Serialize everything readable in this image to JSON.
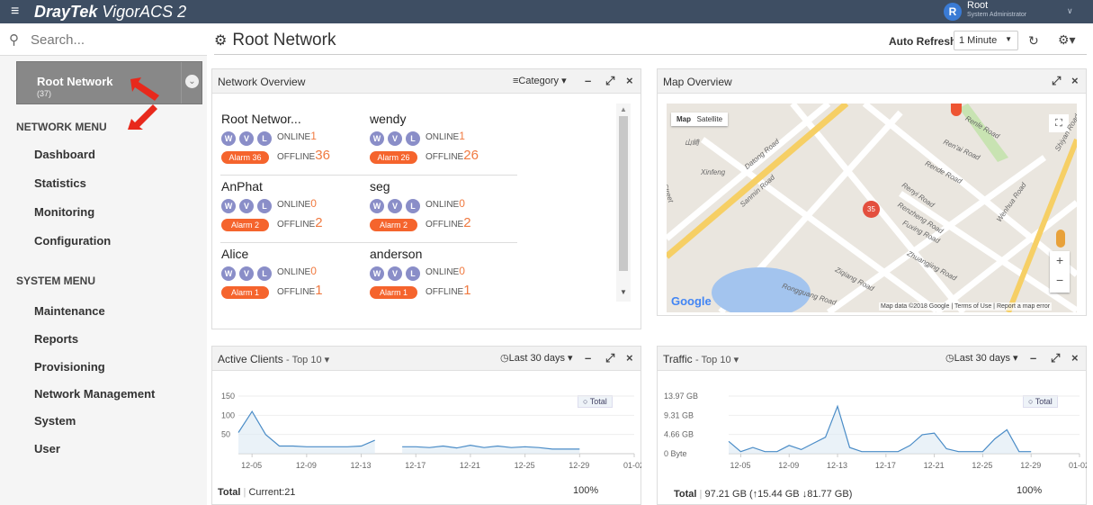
{
  "topbar": {
    "brand": "DrayTek",
    "product": "VigorACS 2",
    "user_initial": "R",
    "user_name": "Root",
    "user_role": "System Administrator"
  },
  "search": {
    "placeholder": "Search..."
  },
  "root_node": {
    "label": "Root Network",
    "count": "(37)"
  },
  "network_menu": {
    "heading": "NETWORK MENU",
    "items": [
      "Dashboard",
      "Statistics",
      "Monitoring",
      "Configuration"
    ]
  },
  "system_menu": {
    "heading": "SYSTEM MENU",
    "items": [
      "Maintenance",
      "Reports",
      "Provisioning",
      "Network Management",
      "System",
      "User"
    ]
  },
  "page": {
    "title": "Root Network",
    "auto_refresh_label": "Auto Refresh:",
    "auto_refresh_value": "1 Minute"
  },
  "network_overview": {
    "title": "Network Overview",
    "category_label": "Category",
    "online_label": "ONLINE",
    "offline_label": "OFFLINE",
    "badges": [
      "W",
      "V",
      "L"
    ],
    "devices": [
      {
        "name": "Root Networ...",
        "online": "1",
        "offline": "36",
        "alarm": "Alarm 36"
      },
      {
        "name": "wendy",
        "online": "1",
        "offline": "26",
        "alarm": "Alarm 26"
      },
      {
        "name": "AnPhat",
        "online": "0",
        "offline": "2",
        "alarm": "Alarm 2"
      },
      {
        "name": "seg",
        "online": "0",
        "offline": "2",
        "alarm": "Alarm 2"
      },
      {
        "name": "Alice",
        "online": "0",
        "offline": "1",
        "alarm": "Alarm 1"
      },
      {
        "name": "anderson",
        "online": "0",
        "offline": "1",
        "alarm": "Alarm 1"
      }
    ]
  },
  "map_overview": {
    "title": "Map Overview",
    "tab_map": "Map",
    "tab_satellite": "Satellite",
    "cluster_count": "35",
    "logo": "Google",
    "attribution": "Map data ©2018 Google",
    "terms": "Terms of Use",
    "report": "Report a map error",
    "zoom_in": "+",
    "zoom_out": "−",
    "places": [
      "Renle Road",
      "Ren'ai Road",
      "Rende Road",
      "Renyi Road",
      "Renzheng Road",
      "Fuxing Road",
      "Zhuangjing Road",
      "Ziqiang Road",
      "Rongguang Road",
      "Datong Road",
      "Sanmin Road",
      "Wenhua Road",
      "Shiyan Road",
      "Xinfeng",
      "Street",
      "山崎"
    ]
  },
  "active_clients": {
    "title": "Active Clients",
    "top_label": "- Top 10",
    "range_label": "Last 30 days",
    "total_label": "Total",
    "current_label": "Current:21",
    "percent": "100%",
    "chart_data": {
      "type": "line",
      "y_ticks": [
        "150",
        "100",
        "50"
      ],
      "x_ticks": [
        "12-05",
        "12-09",
        "12-13",
        "12-17",
        "12-21",
        "12-25",
        "12-29",
        "01-02"
      ],
      "ylim": [
        0,
        150
      ],
      "series": [
        {
          "name": "Total",
          "x": [
            "12-04",
            "12-05",
            "12-06",
            "12-07",
            "12-08",
            "12-09",
            "12-10",
            "12-11",
            "12-12",
            "12-13",
            "12-14",
            "12-15",
            "12-16",
            "12-17",
            "12-18",
            "12-19",
            "12-20",
            "12-21",
            "12-22",
            "12-23",
            "12-24",
            "12-25",
            "12-26",
            "12-27",
            "12-28",
            "12-29"
          ],
          "values": [
            55,
            110,
            50,
            20,
            20,
            18,
            18,
            18,
            18,
            20,
            35,
            null,
            18,
            18,
            16,
            20,
            15,
            22,
            16,
            20,
            16,
            18,
            16,
            12,
            12,
            12
          ]
        }
      ]
    }
  },
  "traffic": {
    "title": "Traffic",
    "top_label": "- Top 10",
    "range_label": "Last 30 days",
    "total_label": "Total",
    "total_value": "97.21 GB",
    "up": "15.44 GB",
    "down": "81.77 GB",
    "percent": "100%",
    "chart_data": {
      "type": "line",
      "y_ticks": [
        "13.97 GB",
        "9.31 GB",
        "4.66 GB",
        "0 Byte"
      ],
      "x_ticks": [
        "12-05",
        "12-09",
        "12-13",
        "12-17",
        "12-21",
        "12-25",
        "12-29",
        "01-02"
      ],
      "ylim": [
        0,
        13.97
      ],
      "series": [
        {
          "name": "Total",
          "x": [
            "12-04",
            "12-05",
            "12-06",
            "12-07",
            "12-08",
            "12-09",
            "12-10",
            "12-11",
            "12-12",
            "12-13",
            "12-14",
            "12-15",
            "12-16",
            "12-17",
            "12-18",
            "12-19",
            "12-20",
            "12-21",
            "12-22",
            "12-23",
            "12-24",
            "12-25",
            "12-26",
            "12-27",
            "12-28",
            "12-29"
          ],
          "values": [
            3,
            0.5,
            1.5,
            0.5,
            0.5,
            2,
            1,
            2.5,
            4,
            11.5,
            1.5,
            0.5,
            0.5,
            0.5,
            0.5,
            2,
            4.6,
            5,
            1.2,
            0.5,
            0.5,
            0.5,
            3.6,
            5.8,
            0.5,
            0.5
          ]
        }
      ]
    }
  }
}
